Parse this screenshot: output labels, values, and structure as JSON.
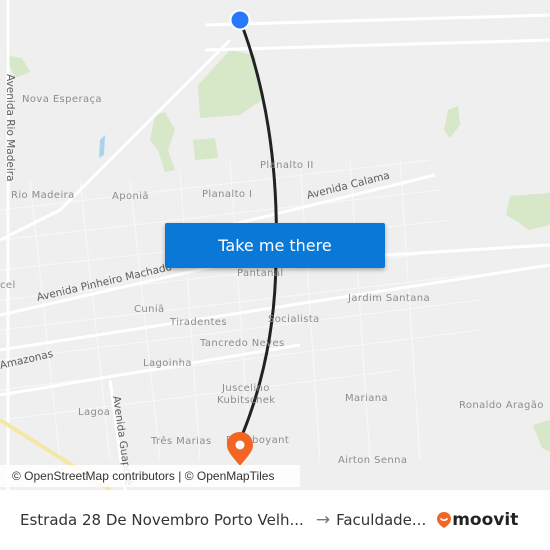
{
  "map": {
    "neighborhood_labels": [
      {
        "text": "Nova Esperaça"
      },
      {
        "text": "Planalto II"
      },
      {
        "text": "Rio Madeira"
      },
      {
        "text": "Aponiã"
      },
      {
        "text": "Planalto I"
      },
      {
        "text": "Pantanal"
      },
      {
        "text": "Jardim Santana"
      },
      {
        "text": "Cuniã"
      },
      {
        "text": "Tiradentes"
      },
      {
        "text": "Socialista"
      },
      {
        "text": "Tancredo Neves"
      },
      {
        "text": "Lagoinha"
      },
      {
        "text": "Juscelino"
      },
      {
        "text": "Kubitschek"
      },
      {
        "text": "Mariana"
      },
      {
        "text": "Lagoa"
      },
      {
        "text": "Ronaldo Aragão"
      },
      {
        "text": "Três Marias"
      },
      {
        "text": "Flamboyant"
      },
      {
        "text": "Airton Senna"
      },
      {
        "text": "cel"
      }
    ],
    "road_labels": [
      {
        "text": "Avenida Rio Madeira"
      },
      {
        "text": "Avenida Calama"
      },
      {
        "text": "Avenida Pinheiro Machado"
      },
      {
        "text": "Amazonas"
      },
      {
        "text": "Avenida Guaporé"
      }
    ],
    "origin_marker_color": "#2979ff",
    "destination_marker_color": "#f26522",
    "route_color": "#222222"
  },
  "cta": {
    "label": "Take me there",
    "color": "#0a78d7"
  },
  "attribution": "© OpenStreetMap contributors | © OpenMapTiles",
  "footer": {
    "from": "Estrada 28 De Novembro Porto Velh...",
    "arrow": "→",
    "to": "Faculdade...",
    "brand": "moovit",
    "brand_color": "#f26522"
  }
}
